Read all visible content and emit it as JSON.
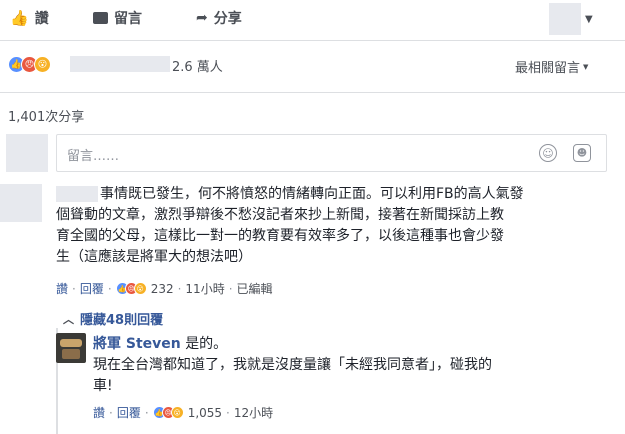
{
  "actions": {
    "like_label": "讚",
    "comment_label": "留言",
    "share_label": "分享"
  },
  "reactions_bar": {
    "count": "2.6 萬人",
    "sort_label": "最相關留言"
  },
  "shares_count": "1,401次分享",
  "composer": {
    "placeholder": "留言……"
  },
  "comments": [
    {
      "text_lines": [
        "事情既已發生，何不將憤怒的情緒轉向正面。可以利用FB的高人氣發",
        "個聳動的文章，激烈爭辯後不愁沒記者來抄上新聞，接著在新聞採訪上教",
        "育全國的父母，這樣比一對一的教育要有效率多了，以後這種事也會少發",
        "生（這應該是將軍大的想法吧）"
      ],
      "like_label": "讚",
      "reply_label": "回覆",
      "reaction_count": "232",
      "time": "11小時",
      "edited": "已編輯"
    }
  ],
  "hidden_replies": "隱藏48則回覆",
  "reply": {
    "author": "將軍 Steven",
    "first_line_suffix": "是的。",
    "text_lines": [
      "現在全台灣都知道了，我就是沒度量讓「未經我同意者」，碰我的",
      "車!"
    ],
    "like_label": "讚",
    "reply_label": "回覆",
    "reaction_count": "1,055",
    "time": "12小時"
  },
  "colors": {
    "link": "#365899",
    "meta": "#4b4f56",
    "like": "#5890ff",
    "angry": "#e9573f",
    "wow": "#f7b125"
  }
}
